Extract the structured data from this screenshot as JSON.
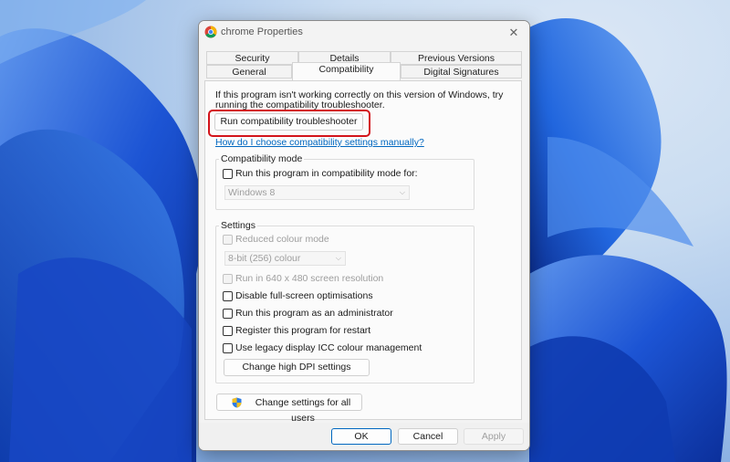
{
  "window": {
    "title": "chrome Properties",
    "close_glyph": "✕",
    "app_icon": "chrome-icon"
  },
  "tabs": {
    "row1": [
      {
        "label": "Security"
      },
      {
        "label": "Details"
      },
      {
        "label": "Previous Versions"
      }
    ],
    "row2": [
      {
        "label": "General"
      },
      {
        "label": "Compatibility",
        "active": true
      },
      {
        "label": "Digital Signatures"
      }
    ]
  },
  "compat": {
    "intro_line1": "If this program isn't working correctly on this version of Windows, try",
    "intro_line2": "running the compatibility troubleshooter.",
    "troubleshooter_button": "Run compatibility troubleshooter",
    "manual_link": "How do I choose compatibility settings manually?"
  },
  "mode_group": {
    "label": "Compatibility mode",
    "checkbox_label": "Run this program in compatibility mode for:",
    "checked": false,
    "select_value": "Windows 8"
  },
  "settings_group": {
    "label": "Settings",
    "reduced_colour": "Reduced colour mode",
    "colour_select": "8-bit (256) colour",
    "run_640": "Run in 640 x 480 screen resolution",
    "disable_fullscreen": "Disable full-screen optimisations",
    "run_admin": "Run this program as an administrator",
    "register_restart": "Register this program for restart",
    "legacy_icc": "Use legacy display ICC colour management",
    "dpi_button": "Change high DPI settings"
  },
  "all_users_button": "Change settings for all users",
  "footer": {
    "ok": "OK",
    "cancel": "Cancel",
    "apply": "Apply"
  },
  "colors": {
    "accent": "#0067c0",
    "highlight": "#d3141b",
    "wallpaper_blue": "#1f5fd6"
  }
}
